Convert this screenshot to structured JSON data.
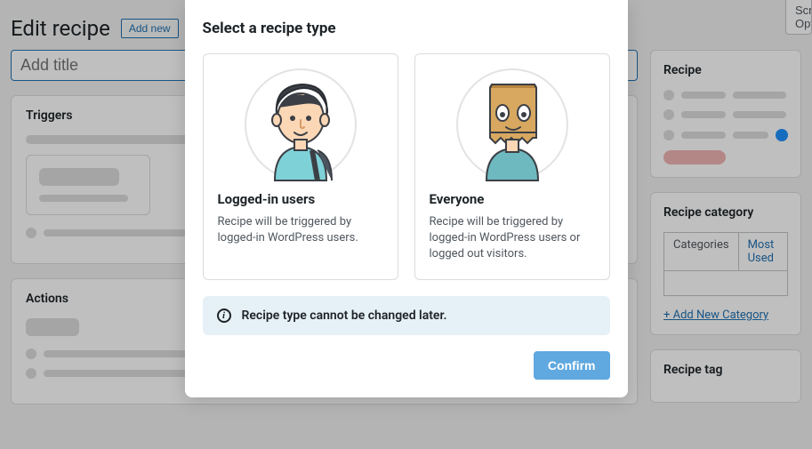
{
  "header": {
    "title": "Edit recipe",
    "add_new_label": "Add new",
    "screen_options": "Screen Options"
  },
  "editor": {
    "title_placeholder": "Add title",
    "triggers_heading": "Triggers",
    "actions_heading": "Actions"
  },
  "sidebar": {
    "recipe": {
      "heading": "Recipe"
    },
    "category": {
      "heading": "Recipe category",
      "tab_categories": "Categories",
      "tab_most_used": "Most Used",
      "add_new": "+ Add New Category"
    },
    "tag": {
      "heading": "Recipe tag"
    }
  },
  "modal": {
    "heading": "Select a recipe type",
    "cards": [
      {
        "title": "Logged-in users",
        "desc": "Recipe will be triggered by logged-in WordPress users."
      },
      {
        "title": "Everyone",
        "desc": "Recipe will be triggered by logged-in WordPress users or logged out visitors."
      }
    ],
    "notice": "Recipe type cannot be changed later.",
    "confirm": "Confirm"
  }
}
